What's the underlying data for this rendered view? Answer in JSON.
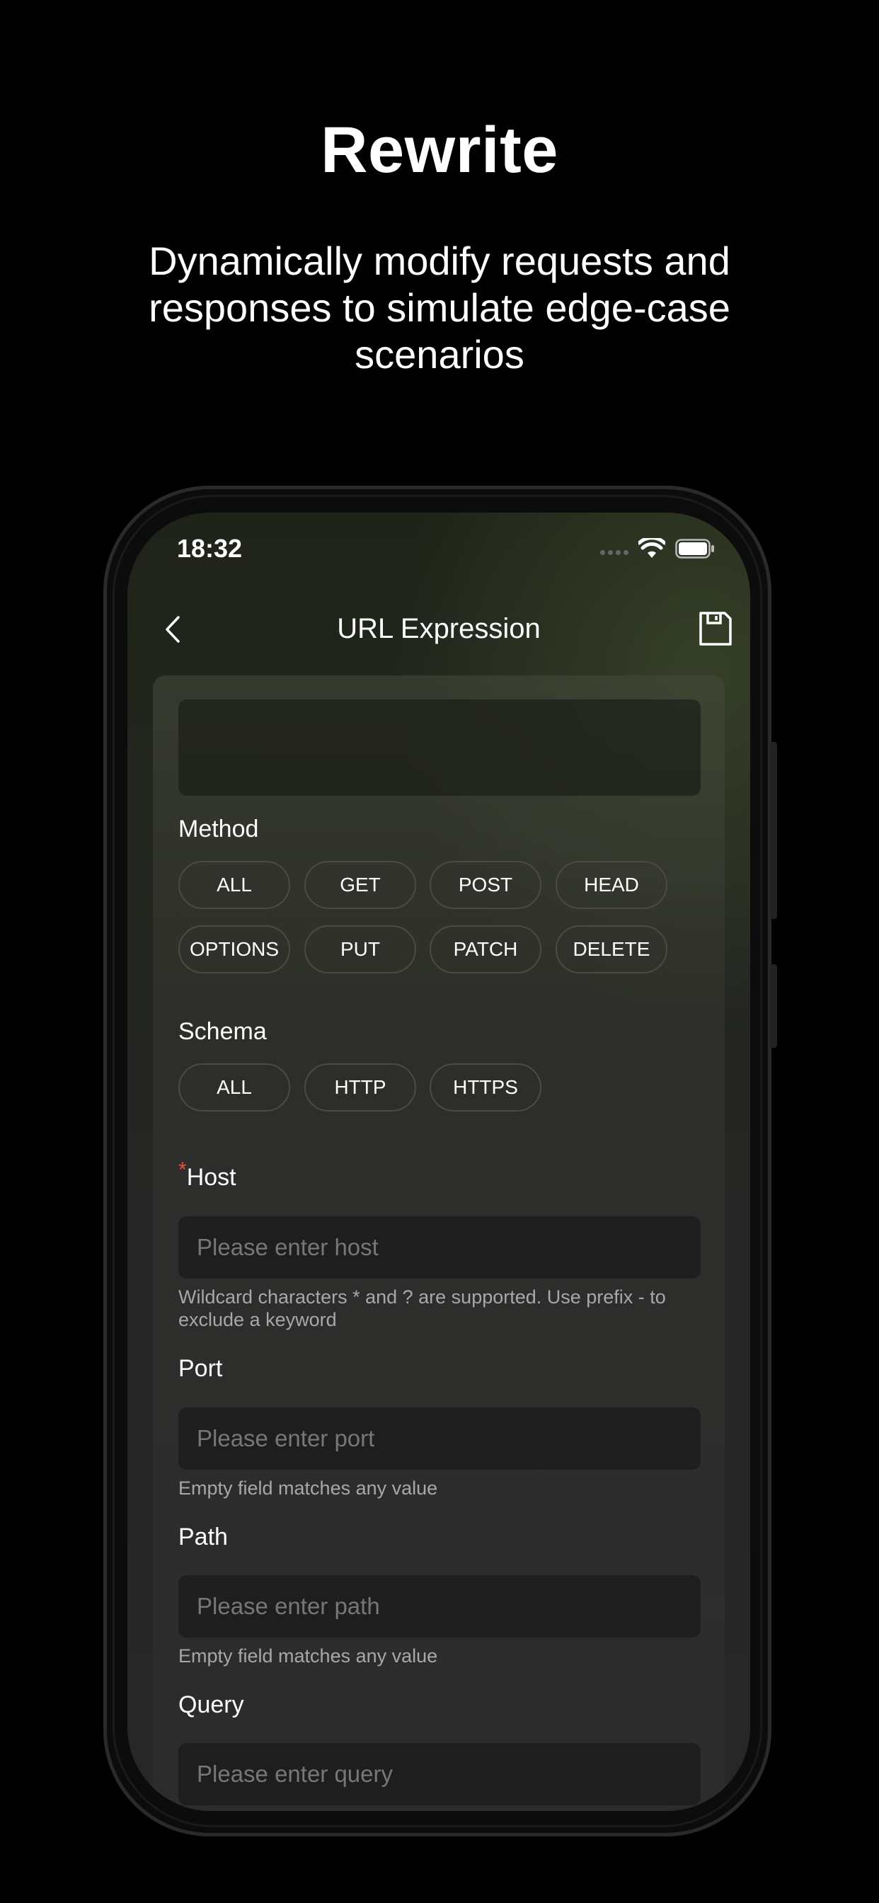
{
  "promo": {
    "title": "Rewrite",
    "subtitle": "Dynamically modify requests and responses to simulate edge-case scenarios"
  },
  "status_bar": {
    "time": "18:32"
  },
  "nav": {
    "title": "URL Expression"
  },
  "method": {
    "label": "Method",
    "options": [
      "ALL",
      "GET",
      "POST",
      "HEAD",
      "OPTIONS",
      "PUT",
      "PATCH",
      "DELETE"
    ]
  },
  "schema": {
    "label": "Schema",
    "options": [
      "ALL",
      "HTTP",
      "HTTPS"
    ]
  },
  "host": {
    "required_mark": "*",
    "label": "Host",
    "placeholder": "Please enter host",
    "hint": "Wildcard characters * and ? are supported. Use prefix - to exclude a keyword"
  },
  "port": {
    "label": "Port",
    "placeholder": "Please enter port",
    "hint": "Empty field matches any value"
  },
  "path": {
    "label": "Path",
    "placeholder": "Please enter path",
    "hint": "Empty field matches any value"
  },
  "query": {
    "label": "Query",
    "placeholder": "Please enter query"
  },
  "colors": {
    "background": "#000000",
    "required": "#e74c3c",
    "chip_border": "#4a4c44",
    "field_bg": "#1e1e1e"
  }
}
